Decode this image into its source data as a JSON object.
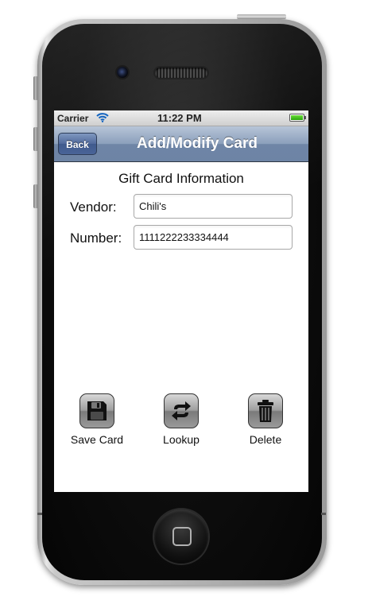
{
  "status_bar": {
    "carrier": "Carrier",
    "time": "11:22 PM",
    "wifi_icon": "wifi-icon",
    "battery_icon": "battery-icon",
    "battery_level": 1.0,
    "battery_color": "#2aa70d"
  },
  "nav": {
    "back_label": "Back",
    "title": "Add/Modify Card",
    "bar_color": "#6d84a5"
  },
  "form": {
    "section_title": "Gift Card Information",
    "vendor_label": "Vendor:",
    "vendor_value": "Chili's",
    "number_label": "Number:",
    "number_value": "1111222233334444"
  },
  "actions": {
    "save": {
      "label": "Save Card",
      "icon": "floppy-disk-icon"
    },
    "lookup": {
      "label": "Lookup",
      "icon": "refresh-arrows-icon"
    },
    "delete": {
      "label": "Delete",
      "icon": "trash-can-icon"
    }
  }
}
